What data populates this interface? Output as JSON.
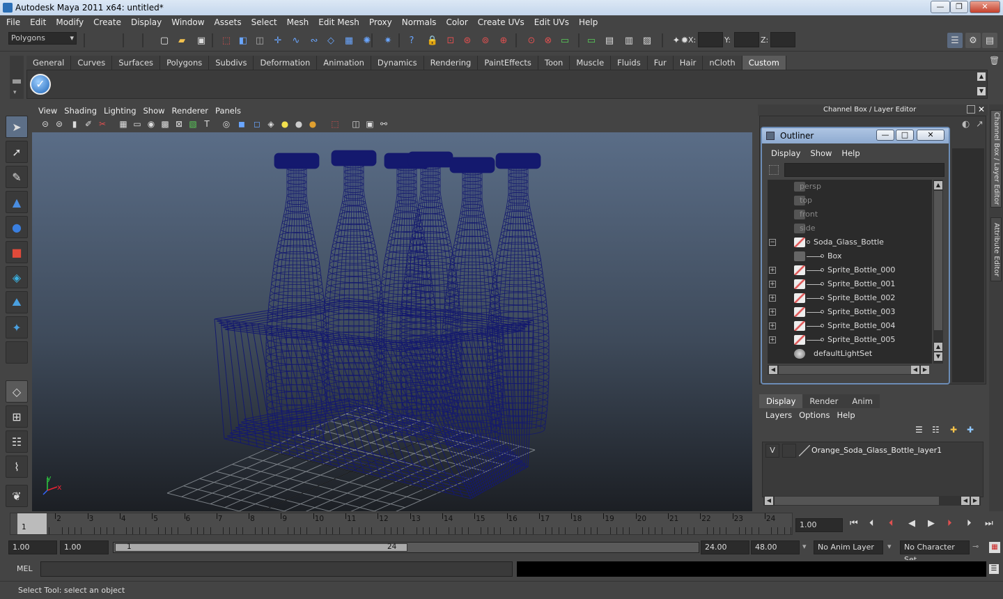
{
  "window": {
    "title": "Autodesk Maya 2011 x64: untitled*",
    "minimize": "—",
    "maximize": "❐",
    "close": "✕"
  },
  "menus": [
    "File",
    "Edit",
    "Modify",
    "Create",
    "Display",
    "Window",
    "Assets",
    "Select",
    "Mesh",
    "Edit Mesh",
    "Proxy",
    "Normals",
    "Color",
    "Create UVs",
    "Edit UVs",
    "Help"
  ],
  "status_line": {
    "menu_set": "Polygons",
    "x_label": "X:",
    "y_label": "Y:",
    "z_label": "Z:"
  },
  "shelf_tabs": [
    "General",
    "Curves",
    "Surfaces",
    "Polygons",
    "Subdivs",
    "Deformation",
    "Animation",
    "Dynamics",
    "Rendering",
    "PaintEffects",
    "Toon",
    "Muscle",
    "Fluids",
    "Fur",
    "Hair",
    "nCloth",
    "Custom"
  ],
  "shelf_active": "Custom",
  "viewport": {
    "menus": [
      "View",
      "Shading",
      "Lighting",
      "Show",
      "Renderer",
      "Panels"
    ],
    "axis_x": "x",
    "axis_y": "y",
    "wire_color": "#14196e"
  },
  "channel_box": {
    "title": "Channel Box / Layer Editor"
  },
  "outliner": {
    "title": "Outliner",
    "minimize": "—",
    "maximize": "□",
    "close": "✕",
    "menus": [
      "Display",
      "Show",
      "Help"
    ],
    "items": [
      {
        "label": "persp",
        "dim": true,
        "indent": 0,
        "expand": ""
      },
      {
        "label": "top",
        "dim": true,
        "indent": 0,
        "expand": ""
      },
      {
        "label": "front",
        "dim": true,
        "indent": 0,
        "expand": ""
      },
      {
        "label": "side",
        "dim": true,
        "indent": 0,
        "expand": ""
      },
      {
        "label": "Soda_Glass_Bottle",
        "dim": false,
        "indent": 0,
        "expand": "−"
      },
      {
        "label": "Box",
        "dim": false,
        "indent": 1,
        "expand": ""
      },
      {
        "label": "Sprite_Bottle_000",
        "dim": false,
        "indent": 1,
        "expand": "+"
      },
      {
        "label": "Sprite_Bottle_001",
        "dim": false,
        "indent": 1,
        "expand": "+"
      },
      {
        "label": "Sprite_Bottle_002",
        "dim": false,
        "indent": 1,
        "expand": "+"
      },
      {
        "label": "Sprite_Bottle_003",
        "dim": false,
        "indent": 1,
        "expand": "+"
      },
      {
        "label": "Sprite_Bottle_004",
        "dim": false,
        "indent": 1,
        "expand": "+"
      },
      {
        "label": "Sprite_Bottle_005",
        "dim": false,
        "indent": 1,
        "expand": "+"
      },
      {
        "label": "defaultLightSet",
        "dim": false,
        "indent": 0,
        "expand": ""
      }
    ]
  },
  "side_tabs": [
    "Channel Box / Layer Editor",
    "Attribute Editor"
  ],
  "layer_editor": {
    "tabs": [
      "Display",
      "Render",
      "Anim"
    ],
    "active_tab": "Display",
    "menus": [
      "Layers",
      "Options",
      "Help"
    ],
    "layers": [
      {
        "visible": "V",
        "name": "Orange_Soda_Glass_Bottle_layer1"
      }
    ]
  },
  "time_slider": {
    "ticks": [
      "1",
      "2",
      "3",
      "4",
      "5",
      "6",
      "7",
      "8",
      "9",
      "10",
      "11",
      "12",
      "13",
      "14",
      "15",
      "16",
      "17",
      "18",
      "19",
      "20",
      "21",
      "22",
      "23",
      "24"
    ],
    "current_frame_marker": "1",
    "current_time": "1.00"
  },
  "range_slider": {
    "start_time": "1.00",
    "playback_start": "1.00",
    "range_start": "1",
    "range_end": "24",
    "playback_end": "24.00",
    "end_time": "48.00",
    "anim_layer": "No Anim Layer",
    "character_set": "No Character Set"
  },
  "command_line": {
    "label": "MEL"
  },
  "help_line": {
    "text": "Select Tool: select an object"
  }
}
